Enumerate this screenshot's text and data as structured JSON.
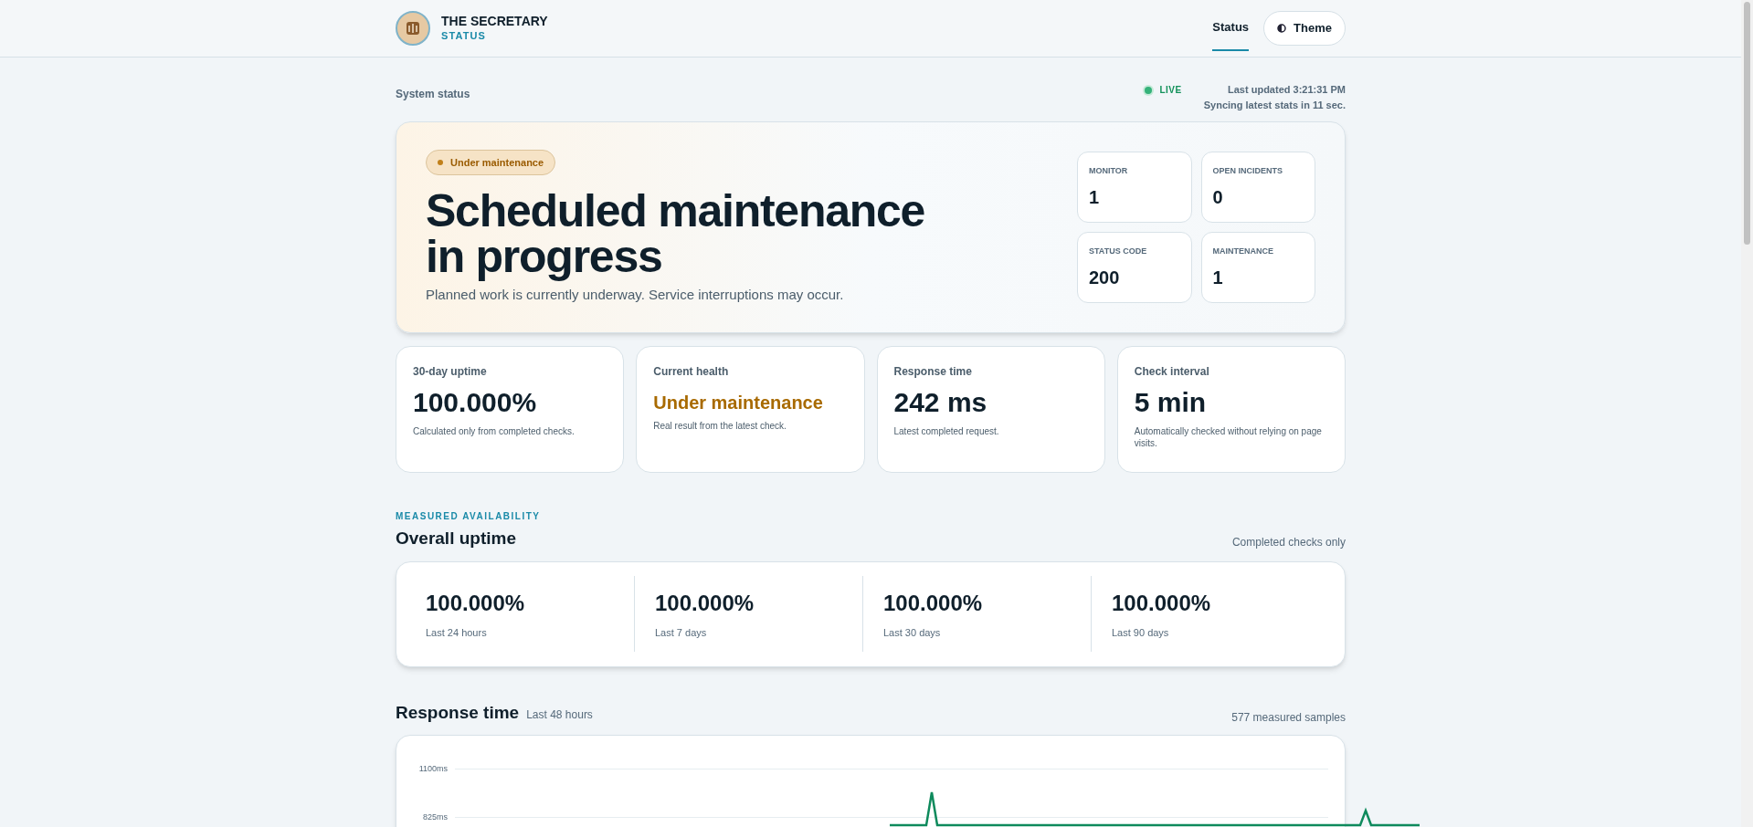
{
  "header": {
    "brand": "THE SECRETARY",
    "subtitle": "STATUS",
    "nav": [
      {
        "label": "Status",
        "selected": true
      },
      {
        "label": "Theme",
        "selected": false
      }
    ]
  },
  "status_bar": {
    "label": "System status",
    "live": "LIVE",
    "updated": "Last updated 3:21:31 PM",
    "syncing": "Syncing latest stats in 11 sec."
  },
  "hero": {
    "badge": "Under maintenance",
    "title": "Scheduled maintenance in progress",
    "description": "Planned work is currently underway. Service interruptions may occur.",
    "stats": [
      {
        "label": "MONITOR",
        "value": "1"
      },
      {
        "label": "OPEN INCIDENTS",
        "value": "0"
      },
      {
        "label": "STATUS CODE",
        "value": "200"
      },
      {
        "label": "MAINTENANCE",
        "value": "1"
      }
    ]
  },
  "cards": [
    {
      "label": "30-day uptime",
      "value": "100.000%",
      "note": "Calculated only from completed checks.",
      "kind": "normal"
    },
    {
      "label": "Current health",
      "value": "Under maintenance",
      "note": "Real result from the latest check.",
      "kind": "warning"
    },
    {
      "label": "Response time",
      "value": "242 ms",
      "note": "Latest completed request.",
      "kind": "normal"
    },
    {
      "label": "Check interval",
      "value": "5 min",
      "note": "Automatically checked without relying on page visits.",
      "kind": "normal"
    }
  ],
  "uptime": {
    "eyebrow": "MEASURED AVAILABILITY",
    "title": "Overall uptime",
    "note": "Completed checks only",
    "periods": [
      {
        "value": "100.000%",
        "label": "Last 24 hours"
      },
      {
        "value": "100.000%",
        "label": "Last 7 days"
      },
      {
        "value": "100.000%",
        "label": "Last 30 days"
      },
      {
        "value": "100.000%",
        "label": "Last 90 days"
      }
    ]
  },
  "response_chart": {
    "title": "Response time",
    "subtitle": "Last 48 hours",
    "samples": "577 measured samples",
    "y_ticks": [
      "1100ms",
      "825ms"
    ]
  }
}
